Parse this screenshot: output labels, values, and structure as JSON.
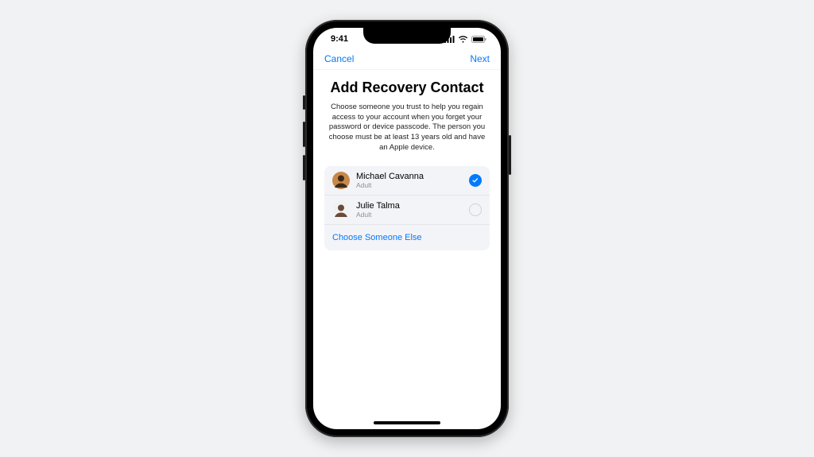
{
  "status": {
    "time": "9:41"
  },
  "nav": {
    "cancel": "Cancel",
    "next": "Next"
  },
  "title": "Add Recovery Contact",
  "description": "Choose someone you trust to help you regain access to your account when you forget your password or device passcode. The person you choose must be at least 13 years old and have an Apple device.",
  "contacts": [
    {
      "name": "Michael Cavanna",
      "subtitle": "Adult",
      "selected": true,
      "avatar_bg": "#c7894a",
      "avatar_fg": "#3d2a1a"
    },
    {
      "name": "Julie Talma",
      "subtitle": "Adult",
      "selected": false,
      "avatar_bg": "#f2f2f2",
      "avatar_fg": "#6b4a3a"
    }
  ],
  "choose_else": "Choose Someone Else",
  "colors": {
    "tint": "#007aff"
  }
}
